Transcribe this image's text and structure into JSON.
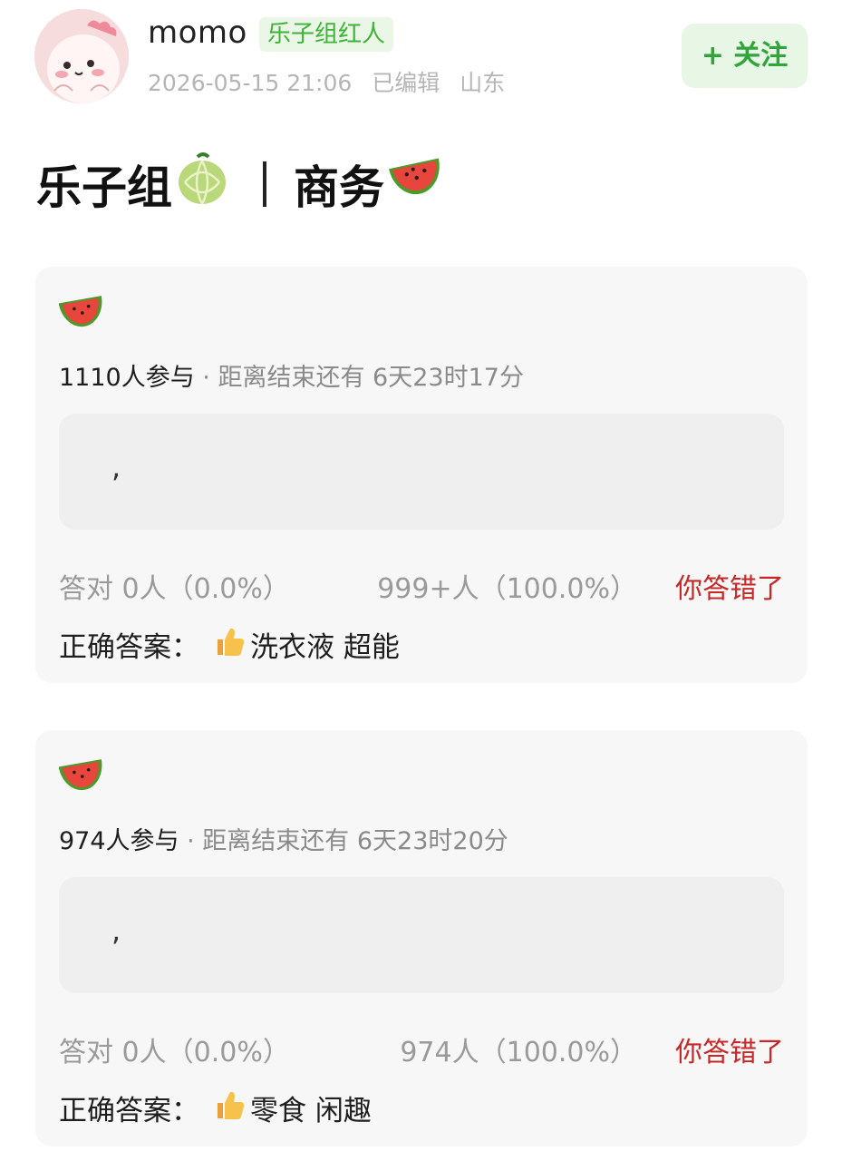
{
  "header": {
    "username": "momo",
    "badge": "乐子组红人",
    "date": "2026-05-15 21:06",
    "edited": "已编辑",
    "location": "山东",
    "follow_label": "+ 关注"
  },
  "post": {
    "title_left": "乐子组",
    "title_right": "商务"
  },
  "polls": [
    {
      "participants": "1110人参与",
      "time_left": " · 距离结束还有 6天23时17分",
      "option_text": ",",
      "correct_stat": "答对  0人（0.0%）",
      "other_stat": "999+人（100.0%）",
      "result": "你答错了",
      "answer_label": "正确答案：",
      "answer_text": "洗衣液 超能"
    },
    {
      "participants": "974人参与",
      "time_left": " · 距离结束还有 6天23时20分",
      "option_text": ",",
      "correct_stat": "答对  0人（0.0%）",
      "other_stat": "974人（100.0%）",
      "result": "你答错了",
      "answer_label": "正确答案：",
      "answer_text": "零食 闲趣"
    }
  ],
  "colors": {
    "brand_green": "#2fa53a",
    "wrong_red": "#c62828",
    "card_bg": "#f7f7f7"
  },
  "icons": [
    "avatar-illustration",
    "melon-icon",
    "watermelon-icon",
    "thumbs-up-icon"
  ]
}
